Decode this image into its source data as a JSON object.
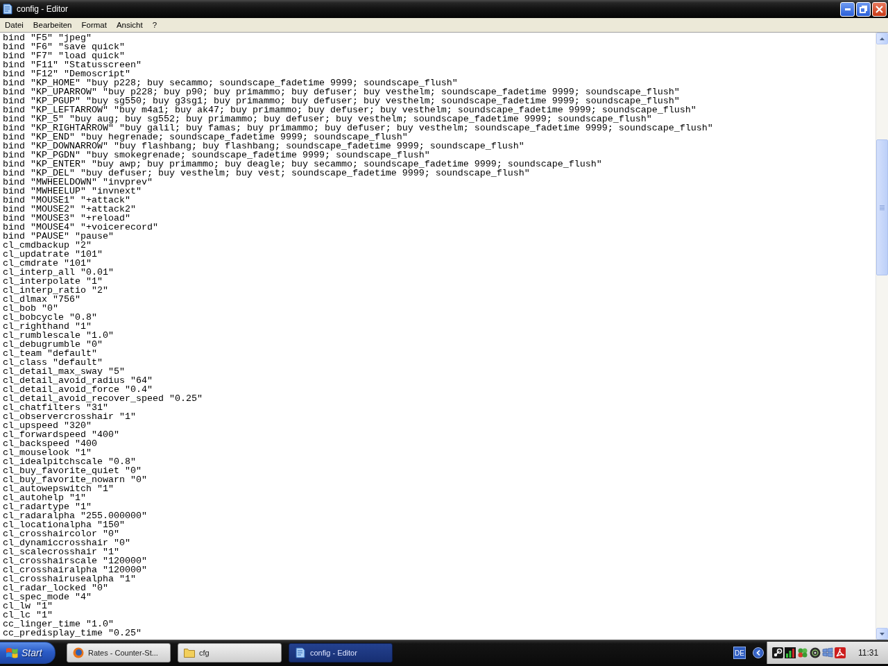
{
  "window": {
    "title": "config - Editor"
  },
  "menu": [
    "Datei",
    "Bearbeiten",
    "Format",
    "Ansicht",
    "?"
  ],
  "editor": {
    "lines": [
      "bind \"F5\" \"jpeg\"",
      "bind \"F6\" \"save quick\"",
      "bind \"F7\" \"load quick\"",
      "bind \"F11\" \"Statusscreen\"",
      "bind \"F12\" \"Demoscript\"",
      "bind \"KP_HOME\" \"buy p228; buy secammo; soundscape_fadetime 9999; soundscape_flush\"",
      "bind \"KP_UPARROW\" \"buy p228; buy p90; buy primammo; buy defuser; buy vesthelm; soundscape_fadetime 9999; soundscape_flush\"",
      "bind \"KP_PGUP\" \"buy sg550; buy g3sg1; buy primammo; buy defuser; buy vesthelm; soundscape_fadetime 9999; soundscape_flush\"",
      "bind \"KP_LEFTARROW\" \"buy m4a1; buy ak47; buy primammo; buy defuser; buy vesthelm; soundscape_fadetime 9999; soundscape_flush\"",
      "bind \"KP_5\" \"buy aug; buy sg552; buy primammo; buy defuser; buy vesthelm; soundscape_fadetime 9999; soundscape_flush\"",
      "bind \"KP_RIGHTARROW\" \"buy galil; buy famas; buy primammo; buy defuser; buy vesthelm; soundscape_fadetime 9999; soundscape_flush\"",
      "bind \"KP_END\" \"buy hegrenade; soundscape_fadetime 9999; soundscape_flush\"",
      "bind \"KP_DOWNARROW\" \"buy flashbang; buy flashbang; soundscape_fadetime 9999; soundscape_flush\"",
      "bind \"KP_PGDN\" \"buy smokegrenade; soundscape_fadetime 9999; soundscape_flush\"",
      "bind \"KP_ENTER\" \"buy awp; buy primammo; buy deagle; buy secammo; soundscape_fadetime 9999; soundscape_flush\"",
      "bind \"KP_DEL\" \"buy defuser; buy vesthelm; buy vest; soundscape_fadetime 9999; soundscape_flush\"",
      "bind \"MWHEELDOWN\" \"invprev\"",
      "bind \"MWHEELUP\" \"invnext\"",
      "bind \"MOUSE1\" \"+attack\"",
      "bind \"MOUSE2\" \"+attack2\"",
      "bind \"MOUSE3\" \"+reload\"",
      "bind \"MOUSE4\" \"+voicerecord\"",
      "bind \"PAUSE\" \"pause\"",
      "cl_cmdbackup \"2\"",
      "cl_updatrate \"101\"",
      "cl_cmdrate \"101\"",
      "cl_interp_all \"0.01\"",
      "cl_interpolate \"1\"",
      "cl_interp_ratio \"2\"",
      "cl_dlmax \"756\"",
      "cl_bob \"0\"",
      "cl_bobcycle \"0.8\"",
      "cl_righthand \"1\"",
      "cl_rumblescale \"1.0\"",
      "cl_debugrumble \"0\"",
      "cl_team \"default\"",
      "cl_class \"default\"",
      "cl_detail_max_sway \"5\"",
      "cl_detail_avoid_radius \"64\"",
      "cl_detail_avoid_force \"0.4\"",
      "cl_detail_avoid_recover_speed \"0.25\"",
      "cl_chatfilters \"31\"",
      "cl_observercrosshair \"1\"",
      "cl_upspeed \"320\"",
      "cl_forwardspeed \"400\"",
      "cl_backspeed \"400",
      "cl_mouselook \"1\"",
      "cl_idealpitchscale \"0.8\"",
      "cl_buy_favorite_quiet \"0\"",
      "cl_buy_favorite_nowarn \"0\"",
      "cl_autowepswitch \"1\"",
      "cl_autohelp \"1\"",
      "cl_radartype \"1\"",
      "cl_radaralpha \"255.000000\"",
      "cl_locationalpha \"150\"",
      "cl_crosshaircolor \"0\"",
      "cl_dynamiccrosshair \"0\"",
      "cl_scalecrosshair \"1\"",
      "cl_crosshairscale \"120000\"",
      "cl_crosshairalpha \"120000\"",
      "cl_crosshairusealpha \"1\"",
      "cl_radar_locked \"0\"",
      "cl_spec_mode \"4\"",
      "cl_lw \"1\"",
      "cl_lc \"1\"",
      "cc_linger_time \"1.0\"",
      "cc_predisplay_time \"0.25\""
    ]
  },
  "taskbar": {
    "start": "Start",
    "tasks": [
      {
        "label": "Rates - Counter-St...",
        "kind": "browser",
        "selected": false
      },
      {
        "label": "cfg",
        "kind": "folder",
        "selected": false
      },
      {
        "label": "config - Editor",
        "kind": "editor",
        "selected": true
      }
    ],
    "language": "DE",
    "clock": "11:31"
  }
}
